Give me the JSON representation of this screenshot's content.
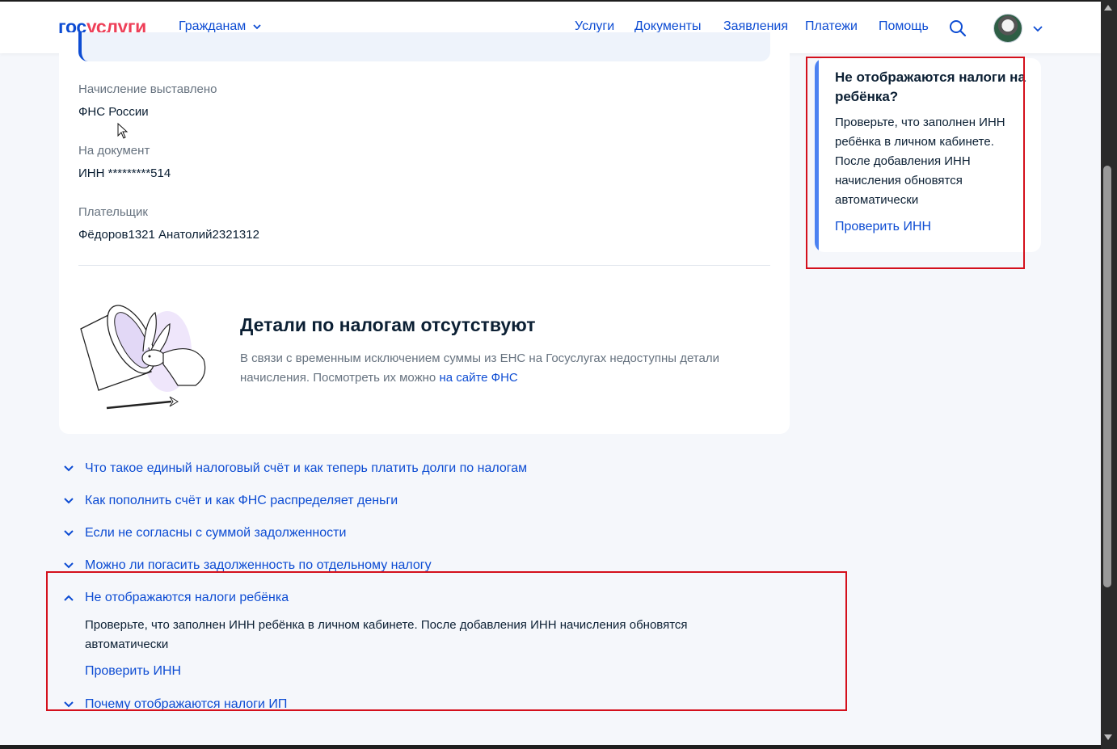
{
  "header": {
    "logo_part1": "гос",
    "logo_part2": "услуги",
    "audience_selector": "Гражданам",
    "nav": [
      "Услуги",
      "Документы",
      "Заявления",
      "Платежи",
      "Помощь"
    ],
    "icons": [
      "search-icon",
      "avatar",
      "chevron-down-icon"
    ]
  },
  "details": {
    "issued_by_label": "Начисление выставлено",
    "issued_by_value": "ФНС России",
    "document_label": "На документ",
    "document_value": "ИНН *********514",
    "payer_label": "Плательщик",
    "payer_value": "Фёдоров1321 Анатолий2321312"
  },
  "empty_state": {
    "title": "Детали по налогам отсутствуют",
    "text": "В связи с временным исключением суммы из ЕНС на Госуслугах недоступны детали начисления. Посмотреть их можно ",
    "link": "на сайте ФНС"
  },
  "side_card": {
    "title": "Не отображаются налоги на ребёнка?",
    "text": "Проверьте, что заполнен ИНН ребёнка в личном кабинете. После добавления ИНН начисления обновятся автоматически",
    "link": "Проверить ИНН"
  },
  "faq": {
    "items": [
      "Что такое единый налоговый счёт и как теперь платить долги по налогам",
      "Как пополнить счёт и как ФНС распределяет деньги",
      "Если не согласны с суммой задолженности",
      "Можно ли погасить задолженность по отдельному налогу",
      "Не отображаются налоги ребёнка",
      "Почему отображаются налоги ИП"
    ],
    "expanded_index": 4,
    "expanded_text": "Проверьте, что заполнен ИНН ребёнка в личном кабинете. После добавления ИНН начисления обновятся автоматически",
    "expanded_link": "Проверить ИНН"
  },
  "colors": {
    "brand_blue": "#0d4cd3",
    "brand_red": "#ee3f58",
    "highlight_red": "#d4101c",
    "side_accent": "#4b81f1"
  }
}
